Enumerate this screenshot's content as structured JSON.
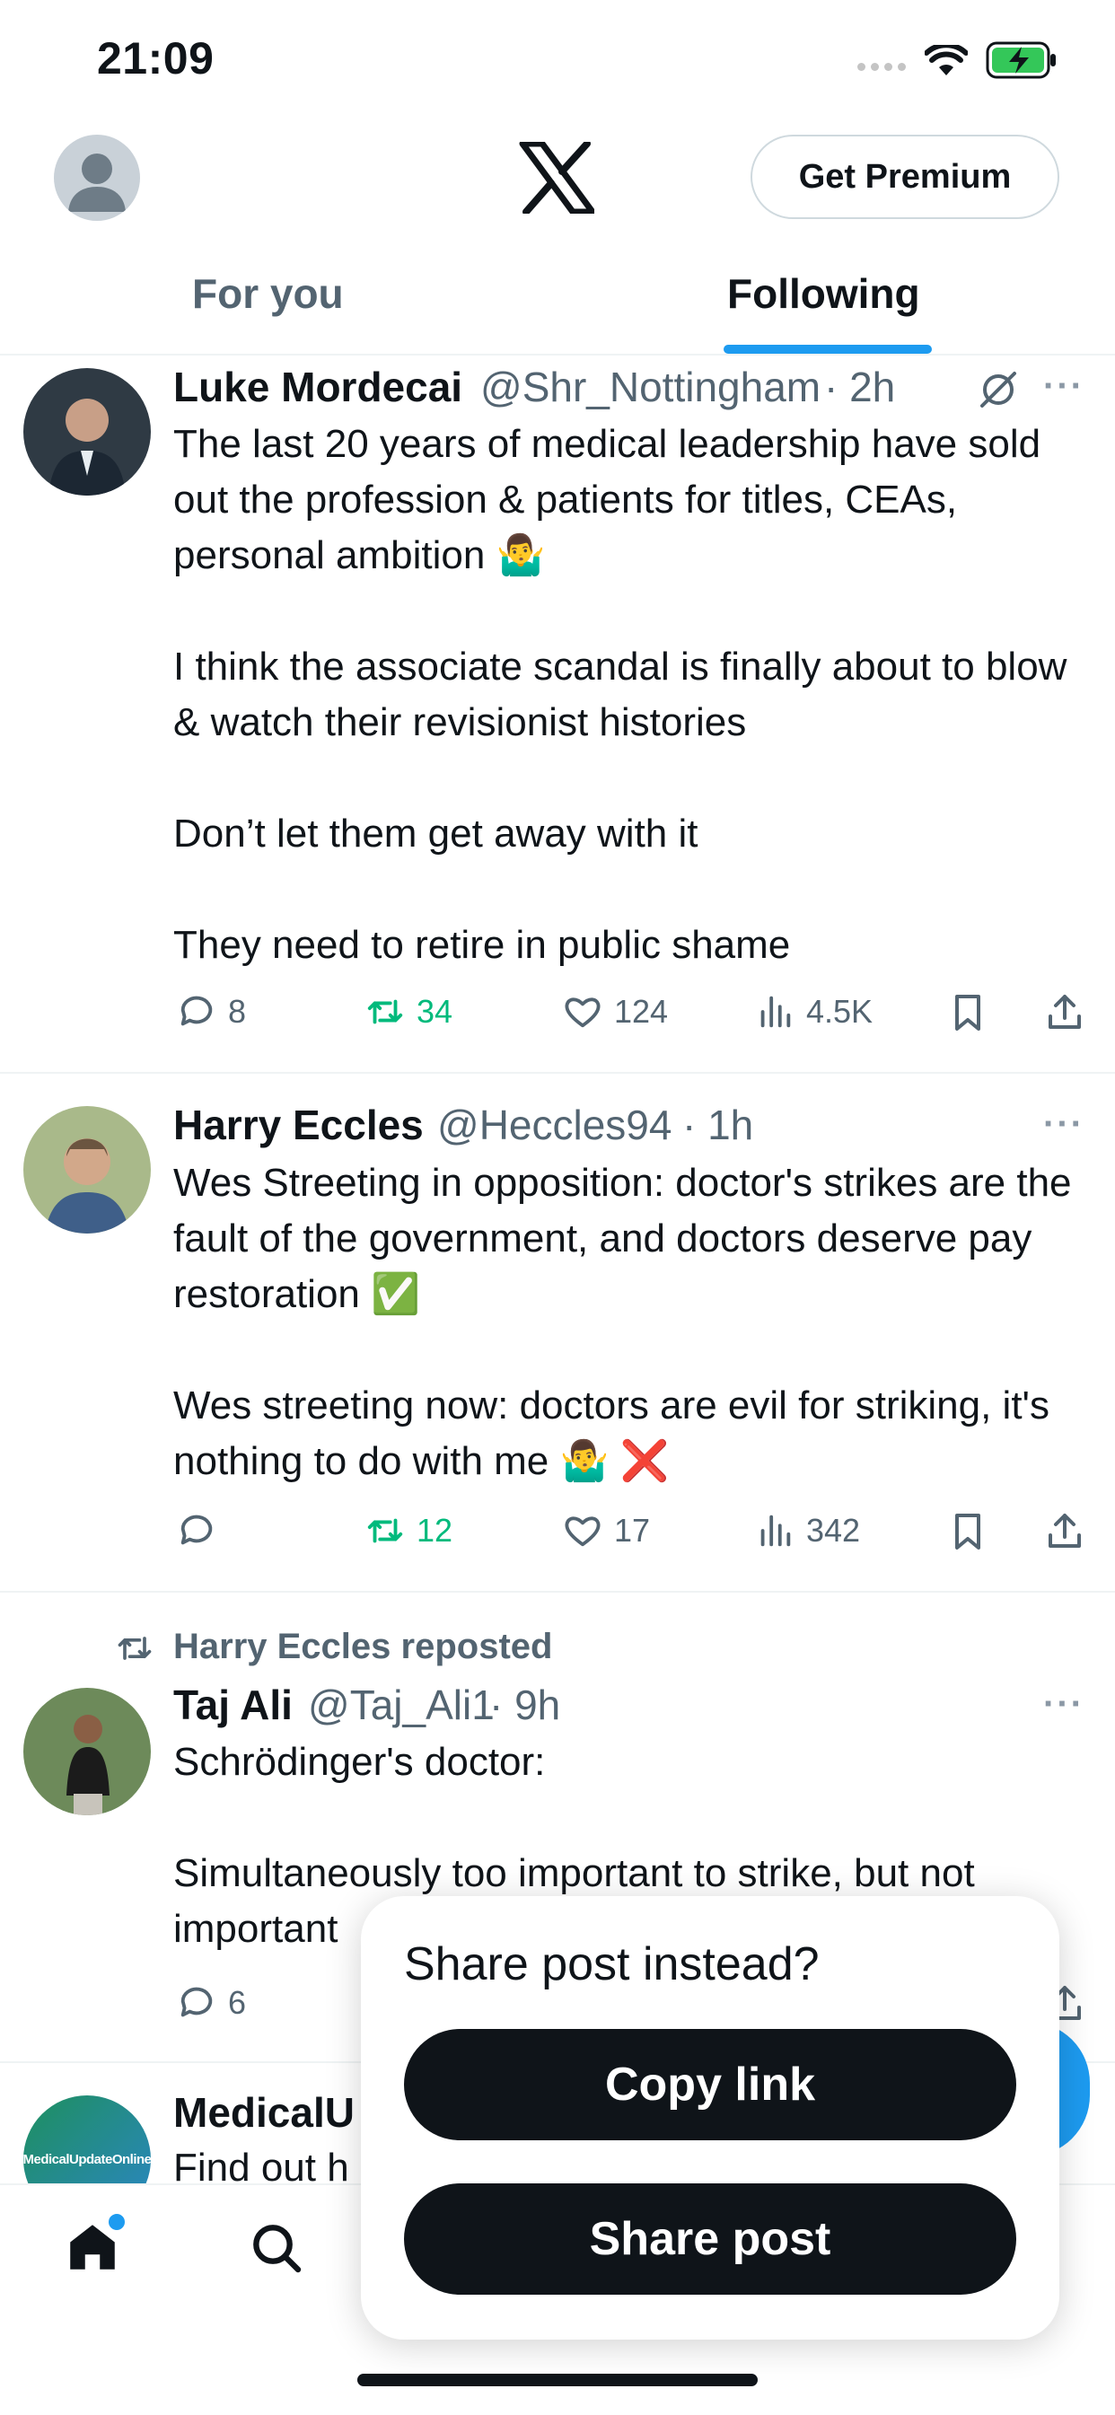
{
  "status": {
    "time": "21:09"
  },
  "header": {
    "premium_label": "Get Premium"
  },
  "tabs": [
    {
      "label": "For you"
    },
    {
      "label": "Following"
    }
  ],
  "posts": [
    {
      "name": "Luke Mordecai",
      "handle": "@Shr_Nottingham",
      "time": "· 2h",
      "text": "The last 20 years of medical leadership have sold out the profession & patients for titles, CEAs, personal ambition 🤷‍♂️\n\nI think the associate scandal is finally about to blow & watch their revisionist histories\n\nDon’t let them get away with it\n\nThey need to retire in public shame",
      "replies": "8",
      "reposts": "34",
      "likes": "124",
      "views": "4.5K"
    },
    {
      "name": "Harry Eccles",
      "handle": "@Heccles94",
      "time": "· 1h",
      "text": "Wes Streeting in opposition: doctor's strikes are the fault of the government, and doctors deserve pay restoration ✅\n\nWes streeting now: doctors are evil for striking, it's nothing to do with me 🤷‍♂️ ❌",
      "replies": "",
      "reposts": "12",
      "likes": "17",
      "views": "342"
    },
    {
      "repost_label": "Harry Eccles reposted",
      "name": "Taj Ali",
      "handle": "@Taj_Ali1",
      "time": "· 9h",
      "text": "Schrödinger's doctor:\n\nSimultaneously too important to strike, but not important",
      "replies": "6"
    },
    {
      "name": "MedicalU",
      "text": "Find out h",
      "avatar_text": "MedicalUpdateOnline"
    }
  ],
  "popup": {
    "title": "Share post instead?",
    "copy_link": "Copy link",
    "share_post": "Share post"
  },
  "colors": {
    "accent": "#1d9bf0",
    "repost_green": "#00ba7c",
    "text": "#0f1419",
    "muted": "#536471"
  }
}
